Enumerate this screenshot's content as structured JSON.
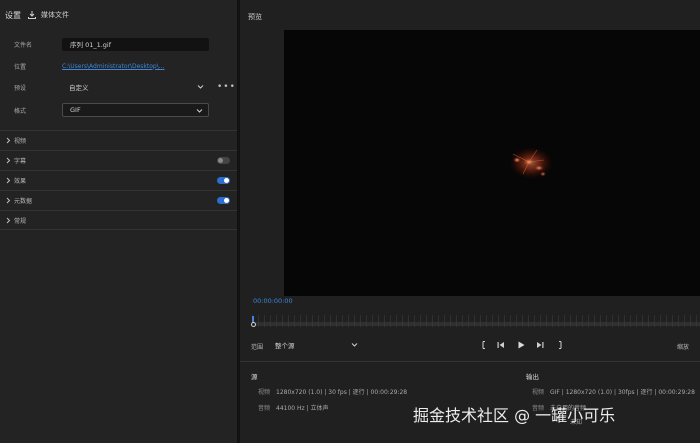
{
  "left_header": {
    "title": "设置",
    "media_label": "媒体文件"
  },
  "fields": {
    "filename_label": "文件名",
    "filename_value": "序列 01_1.gif",
    "location_label": "位置",
    "location_value": "C:\\Users\\Administrator\\Desktop\\...",
    "preset_label": "预设",
    "preset_value": "自定义",
    "format_label": "格式",
    "format_value": "GIF",
    "more_label": "•••"
  },
  "sections": [
    {
      "label": "视频",
      "toggle": null
    },
    {
      "label": "字幕",
      "toggle": "off"
    },
    {
      "label": "效果",
      "toggle": "on"
    },
    {
      "label": "元数据",
      "toggle": "on"
    },
    {
      "label": "常规",
      "toggle": null
    }
  ],
  "preview": {
    "title": "预览",
    "timecode": "00:00:00:00",
    "range_label": "范围",
    "range_value": "整个源",
    "zoom_label": "缩放"
  },
  "source": {
    "title": "源",
    "video_label": "视频",
    "video_value": "1280x720 (1.0) | 30 fps | 逐行 | 00:00:29:28",
    "audio_label": "音频",
    "audio_value": "44100 Hz | 立体声"
  },
  "output": {
    "title": "输出",
    "video_label": "视频",
    "video_value": "GIF | 1280x720 (1.0) | 30fps | 逐行 | 00:00:29:28",
    "audio_label": "音频",
    "audio_value": "未启用的音频",
    "extra_value": "未知"
  },
  "watermark": "掘金技术社区 @ 一罐小可乐",
  "colors": {
    "accent": "#3f86d9",
    "toggle_on": "#2d6fd1",
    "panel": "#232323",
    "video_bg": "#060606"
  }
}
